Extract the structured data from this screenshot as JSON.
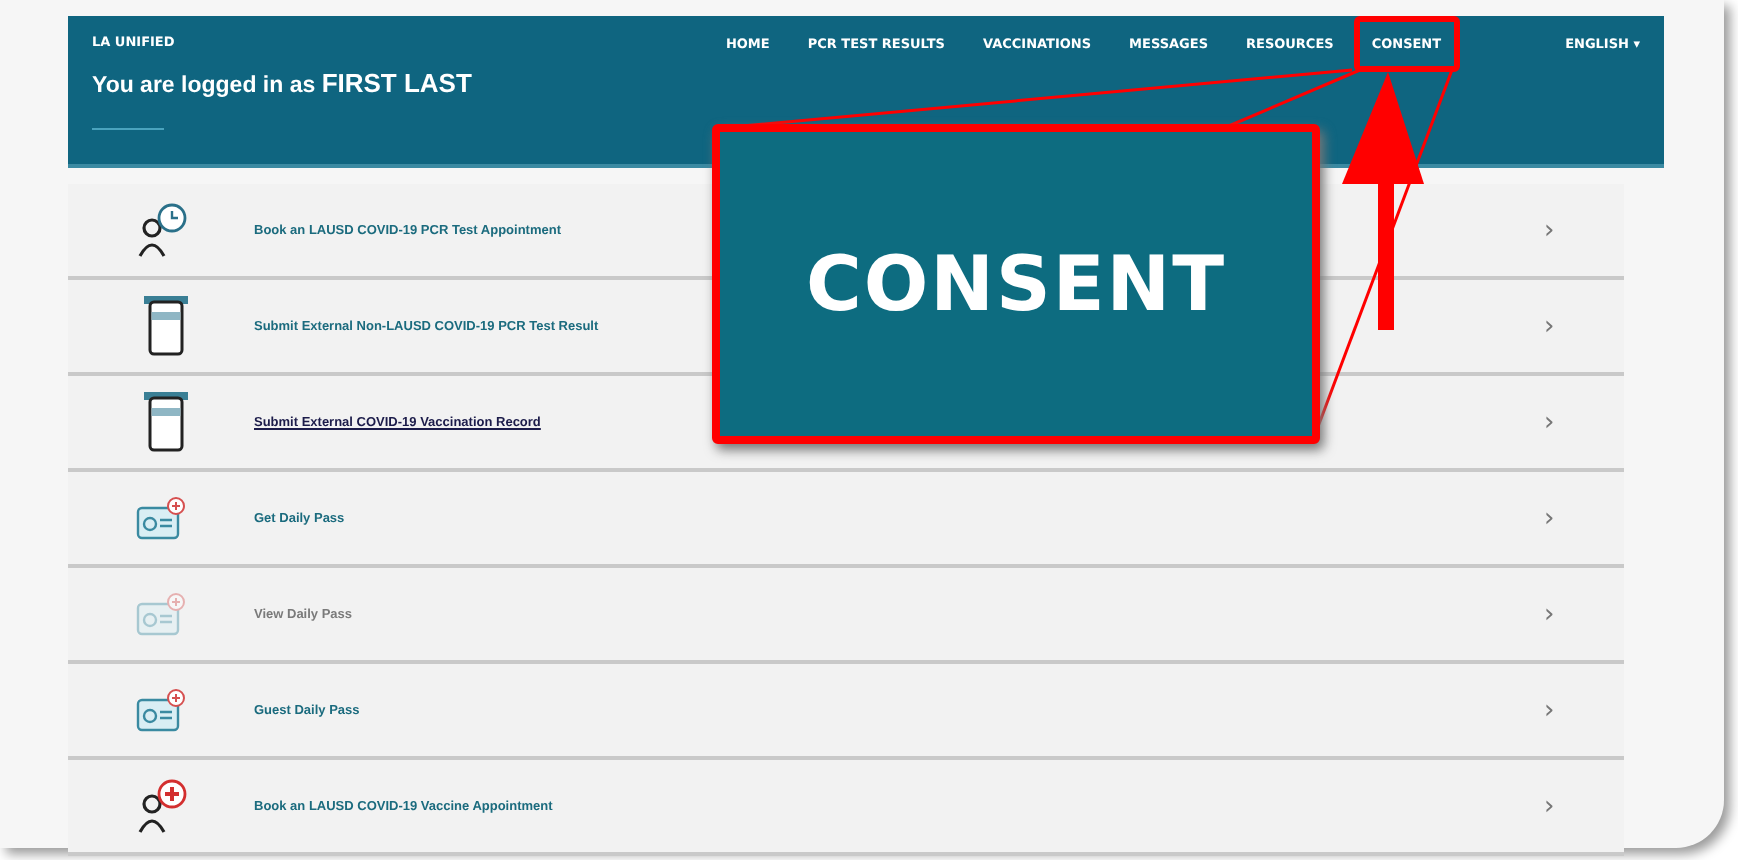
{
  "header": {
    "brand": "LA UNIFIED",
    "title": "You are logged in as ",
    "user": "FIRST LAST",
    "nav": [
      {
        "label": "HOME",
        "highlighted": false
      },
      {
        "label": "PCR TEST RESULTS",
        "highlighted": false
      },
      {
        "label": "VACCINATIONS",
        "highlighted": false
      },
      {
        "label": "MESSAGES",
        "highlighted": false
      },
      {
        "label": "RESOURCES",
        "highlighted": false
      },
      {
        "label": "CONSENT",
        "highlighted": true
      }
    ],
    "language": "ENGLISH",
    "language_caret": "▾"
  },
  "items": [
    {
      "kind": "appointment",
      "label": "Book an LAUSD COVID-19 PCR Test Appointment",
      "disabled": false,
      "visited": false,
      "chevron": "›"
    },
    {
      "kind": "document",
      "label": "Submit External Non-LAUSD COVID-19 PCR Test Result",
      "disabled": false,
      "visited": false,
      "chevron": "›"
    },
    {
      "kind": "document",
      "label": "Submit External COVID-19 Vaccination Record",
      "disabled": false,
      "visited": true,
      "chevron": "›"
    },
    {
      "kind": "pass",
      "label": "Get Daily Pass",
      "disabled": false,
      "visited": false,
      "chevron": "›"
    },
    {
      "kind": "pass",
      "label": "View Daily Pass",
      "disabled": true,
      "visited": false,
      "chevron": "›"
    },
    {
      "kind": "pass",
      "label": "Guest Daily Pass",
      "disabled": false,
      "visited": false,
      "chevron": "›"
    },
    {
      "kind": "vaccine",
      "label": "Book an LAUSD COVID-19 Vaccine Appointment",
      "disabled": false,
      "visited": false,
      "chevron": "›"
    }
  ],
  "callout": {
    "text": "CONSENT"
  }
}
